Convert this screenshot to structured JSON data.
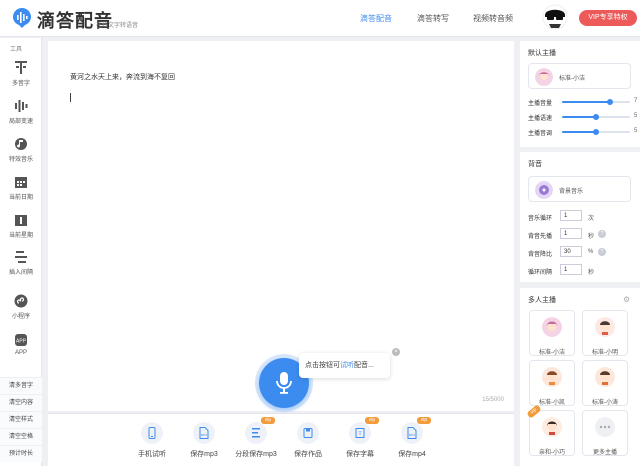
{
  "header": {
    "app_title": "滴答配音",
    "app_subtitle": "在线文字转语音",
    "nav": [
      "滴答配音",
      "滴答转写",
      "视频转音频"
    ],
    "active_nav": 0,
    "vip_label": "VIP专享特权",
    "accent_color": "#3c8cf0",
    "vip_color": "#ec5a5a"
  },
  "sidebar": {
    "section_label": "工具",
    "tools": [
      {
        "label": "多音字",
        "icon": "polyphone-icon"
      },
      {
        "label": "局部变速",
        "icon": "speed-icon"
      },
      {
        "label": "特效音乐",
        "icon": "music-icon"
      },
      {
        "label": "当前日期",
        "icon": "calendar-icon"
      },
      {
        "label": "当前星期",
        "icon": "week-icon"
      },
      {
        "label": "插入间隔",
        "icon": "interval-icon"
      },
      {
        "label": "小程序",
        "icon": "mini-program-icon"
      },
      {
        "label": "APP",
        "icon": "app-icon"
      }
    ],
    "links": [
      "清多音字",
      "清空内容",
      "清空样式",
      "清空空格",
      "预计时长"
    ]
  },
  "editor": {
    "text": "黄河之水天上来，奔流到海不复回",
    "counter": "15/5000"
  },
  "mic": {
    "tip_prefix": "点击按钮可",
    "tip_highlight": "试听",
    "tip_suffix": "配音...",
    "close_label": "×"
  },
  "toolbar": {
    "items": [
      {
        "label": "手机试听",
        "icon": "phone-icon",
        "vip": false
      },
      {
        "label": "保存mp3",
        "icon": "mp3-icon",
        "vip": false
      },
      {
        "label": "分段保存mp3",
        "icon": "segment-icon",
        "vip": true
      },
      {
        "label": "保存作品",
        "icon": "save-work-icon",
        "vip": false
      },
      {
        "label": "保存字幕",
        "icon": "subtitle-icon",
        "vip": true
      },
      {
        "label": "保存mp4",
        "icon": "mp4-icon",
        "vip": true
      }
    ],
    "vip_tag": "vip"
  },
  "default_speaker": {
    "title": "默认主播",
    "voice_name": "标准-小洁",
    "sliders": [
      {
        "label": "主播音量",
        "value": 7,
        "max": 10
      },
      {
        "label": "主播语速",
        "value": 5,
        "max": 10
      },
      {
        "label": "主播音调",
        "value": 5,
        "max": 10
      }
    ]
  },
  "background": {
    "title": "背音",
    "music_name": "背景音乐",
    "fields": [
      {
        "label": "音乐循环",
        "value": "1",
        "unit": "次",
        "help": false
      },
      {
        "label": "背音先播",
        "value": "1",
        "unit": "秒",
        "help": true
      },
      {
        "label": "背音降比",
        "value": "30",
        "unit": "%",
        "help": true
      },
      {
        "label": "循环间隔",
        "value": "1",
        "unit": "秒",
        "help": false
      }
    ]
  },
  "multi_speaker": {
    "title": "多人主播",
    "speakers": [
      "标准-小洁",
      "标准-小明",
      "标准-小凯",
      "标准-小涛",
      "亲和-小巧",
      "更多主播"
    ],
    "vip_tag": "vip"
  }
}
